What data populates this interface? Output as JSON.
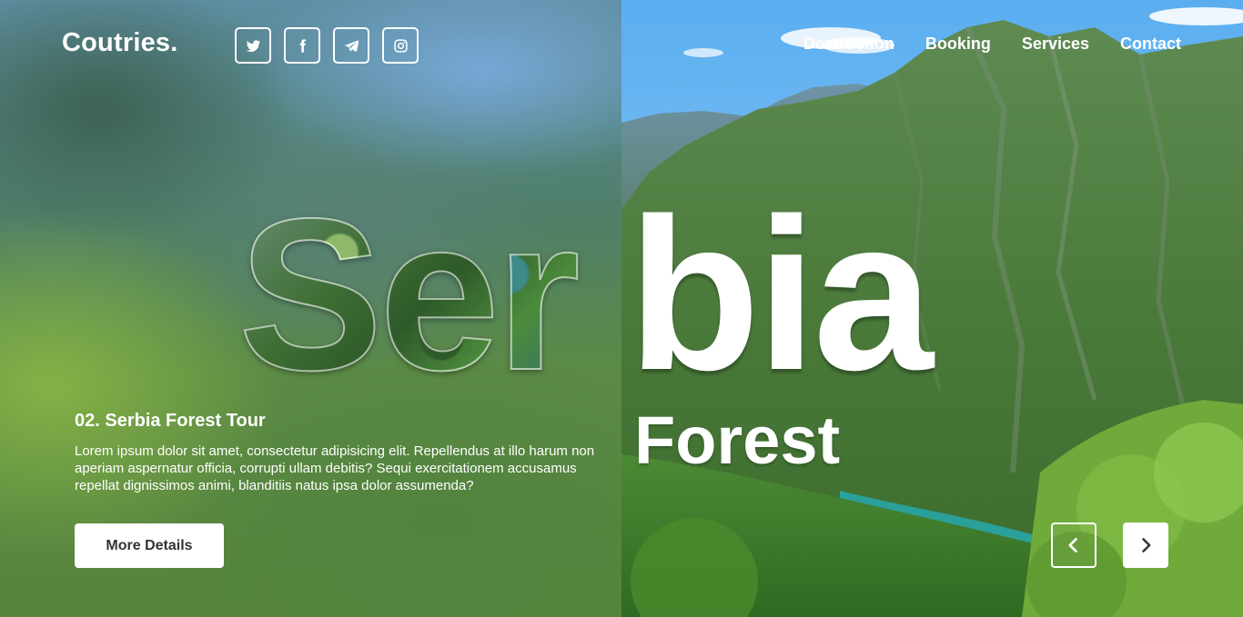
{
  "brand": {
    "logo": "Coutries."
  },
  "socials": [
    {
      "icon": "twitter-icon"
    },
    {
      "icon": "facebook-icon"
    },
    {
      "icon": "telegram-icon"
    },
    {
      "icon": "instagram-icon"
    }
  ],
  "nav": [
    {
      "label": "Destruction"
    },
    {
      "label": "Booking"
    },
    {
      "label": "Services"
    },
    {
      "label": "Contact"
    }
  ],
  "hero": {
    "title_part1": "Ser",
    "title_part2": "bia",
    "subtitle": "Forest"
  },
  "tour": {
    "title": "02. Serbia Forest Tour",
    "description": "Lorem ipsum dolor sit amet, consectetur adipisicing elit. Repellendus at illo harum non aperiam aspernatur officia, corrupti ullam debitis? Sequi exercitationem accusamus repellat dignissimos animi, blanditiis natus ipsa dolor assumenda?",
    "button_label": "More Details"
  },
  "slider": {
    "prev_icon": "chevron-left-icon",
    "next_icon": "chevron-right-icon"
  },
  "colors": {
    "text": "#ffffff",
    "button_bg": "#ffffff",
    "button_text": "#333333",
    "sky": "#9fcdf0",
    "forest": "#3f7a2a",
    "river": "#2a9a8a"
  }
}
